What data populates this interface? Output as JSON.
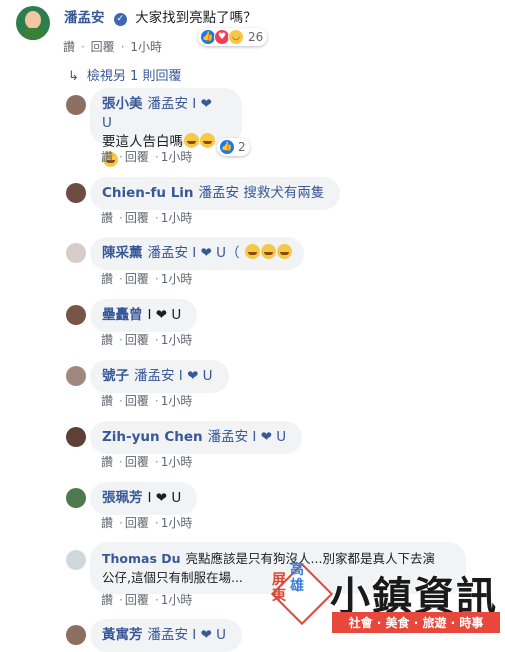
{
  "actions": {
    "like": "讚",
    "reply": "回覆",
    "time": "1小時"
  },
  "main": {
    "author": "潘孟安",
    "text": "大家找到亮點了嗎？",
    "reaction_count": "26",
    "view_more": "檢視另 1 則回覆"
  },
  "replies": [
    {
      "name": "張小美",
      "body": "潘孟安 I ❤ U",
      "line2": "要這人告白嗎",
      "reaction_count": "2"
    },
    {
      "name": "Chien-fu Lin",
      "body": "潘孟安 搜救犬有兩隻"
    },
    {
      "name": "陳采薰",
      "body": "潘孟安 I ❤ U（"
    },
    {
      "name": "壘矗曾",
      "body": "I ❤ U"
    },
    {
      "name": "號子",
      "body": "潘孟安 I ❤ U"
    },
    {
      "name": "Zih-yun Chen",
      "body": "潘孟安 I ❤ U"
    },
    {
      "name": "張珮芳",
      "body": "I ❤ U"
    },
    {
      "name": "Thomas Du",
      "body": "亮點應該是只有狗沒人...別家都是真人下去演",
      "line2": "公仔,這個只有制服在場..."
    },
    {
      "name": "黃寓芳",
      "body": "潘孟安 I ❤ U"
    }
  ],
  "watermark": {
    "left": "屏東",
    "right": "高雄",
    "title": "小鎮資訊",
    "subtitle": "社會 · 美食 · 旅遊 · 時事"
  }
}
